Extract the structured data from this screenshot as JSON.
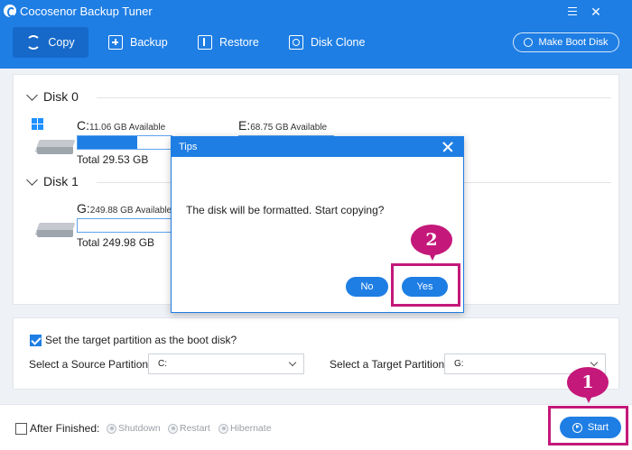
{
  "window": {
    "title": "Cocosenor Backup Tuner"
  },
  "toolbar": {
    "copy": "Copy",
    "backup": "Backup",
    "restore": "Restore",
    "disk_clone": "Disk Clone",
    "make_boot_disk": "Make Boot Disk"
  },
  "disks": [
    {
      "name": "Disk 0",
      "partitions": [
        {
          "letter": "C:",
          "available": "11.06 GB Available",
          "total": "Total 29.53 GB",
          "used_fraction": 0.63,
          "system": true
        },
        {
          "letter": "E:",
          "available": "68.75 GB Available",
          "total": "",
          "used_fraction": 0.0,
          "system": false
        }
      ]
    },
    {
      "name": "Disk 1",
      "partitions": [
        {
          "letter": "G:",
          "available": "249.88 GB Available",
          "total": "Total 249.98 GB",
          "used_fraction": 0.0,
          "system": false
        }
      ]
    }
  ],
  "options": {
    "boot_checkbox_label": "Set the target partition as the boot disk?",
    "boot_checked": true,
    "source_label": "Select a Source Partition:",
    "source_value": "C:",
    "target_label": "Select a Target Partition:",
    "target_value": "G:"
  },
  "bottom": {
    "after_finished": "After Finished:",
    "after_checked": false,
    "radios": [
      "Shutdown",
      "Restart",
      "Hibernate"
    ],
    "start": "Start"
  },
  "dialog": {
    "title": "Tips",
    "message": "The disk will be formatted. Start copying?",
    "no": "No",
    "yes": "Yes"
  },
  "annotations": {
    "step1": "1",
    "step2": "2",
    "color": "#c4187a"
  },
  "colors": {
    "accent": "#1e7ee4",
    "toolbar_active": "#1669c9"
  }
}
